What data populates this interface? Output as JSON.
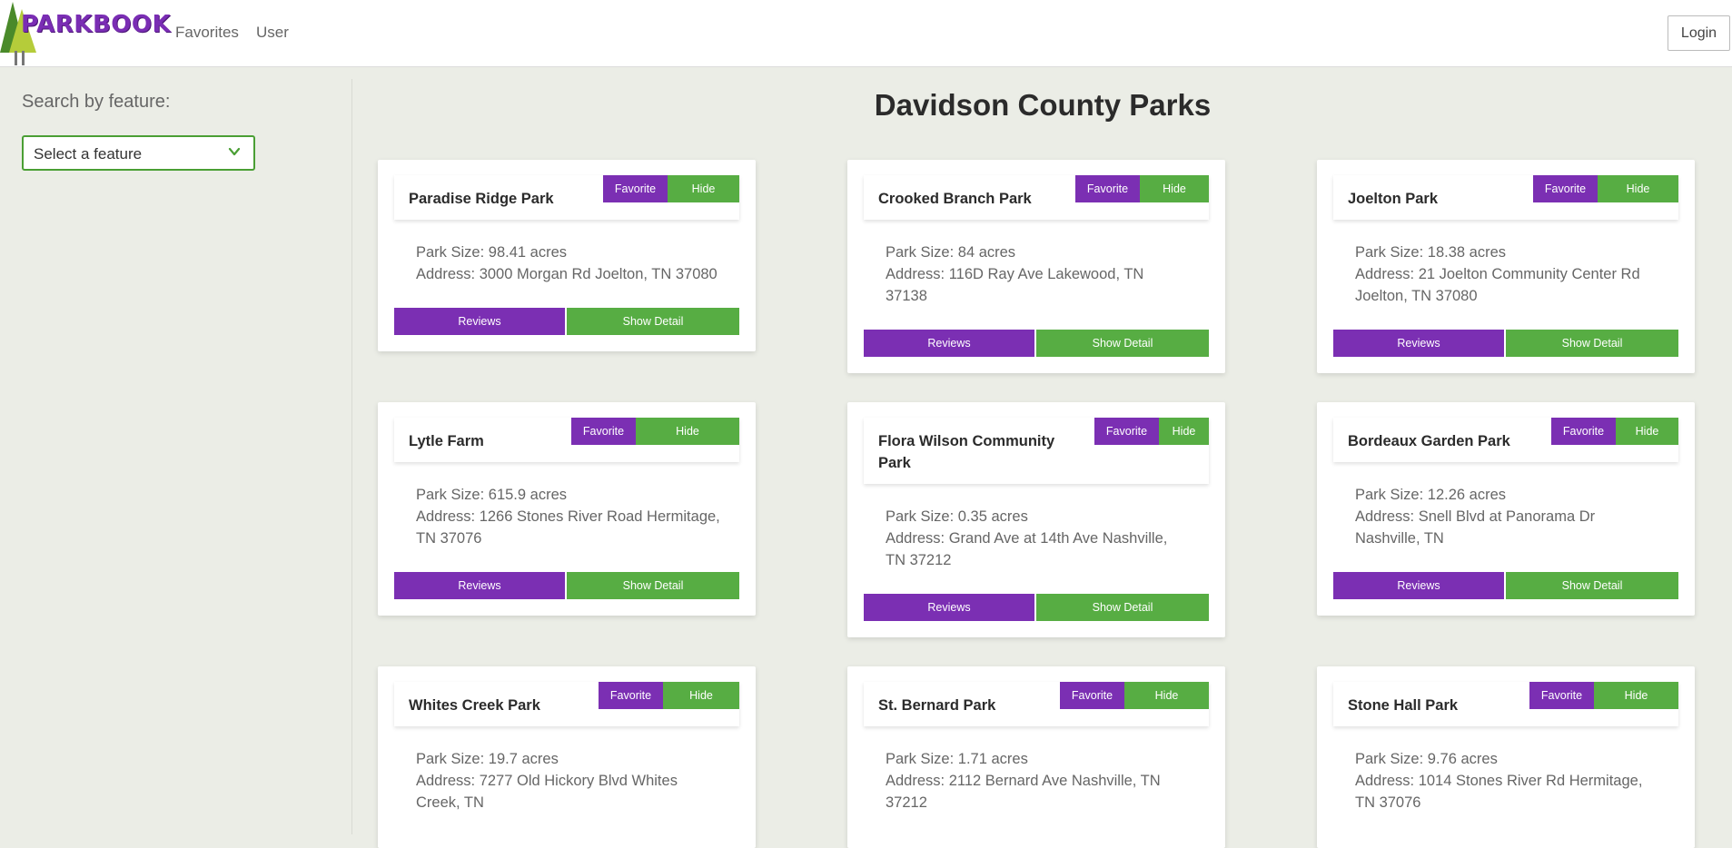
{
  "nav": {
    "logo_text": "PARKBOOK",
    "links": [
      "Favorites",
      "User"
    ],
    "login_label": "Login"
  },
  "sidebar": {
    "label": "Search by feature:",
    "select_value": "Select a feature",
    "select_icon": "chevron-down-icon"
  },
  "main": {
    "title": "Davidson County Parks",
    "parks": [
      {
        "name": "Paradise Ridge Park",
        "size": "Park Size: 98.41 acres",
        "address": "Address: 3000 Morgan Rd Joelton, TN 37080"
      },
      {
        "name": "Crooked Branch Park",
        "size": "Park Size: 84 acres",
        "address": "Address: 116D Ray Ave Lakewood, TN 37138"
      },
      {
        "name": "Joelton Park",
        "size": "Park Size: 18.38 acres",
        "address": "Address: 21 Joelton Community Center Rd Joelton, TN 37080"
      },
      {
        "name": "Lytle Farm",
        "size": "Park Size: 615.9 acres",
        "address": "Address: 1266 Stones River Road Hermitage, TN 37076"
      },
      {
        "name": "Flora Wilson Community Park",
        "size": "Park Size: 0.35 acres",
        "address": "Address: Grand Ave at 14th Ave Nashville, TN 37212"
      },
      {
        "name": "Bordeaux Garden Park",
        "size": "Park Size: 12.26 acres",
        "address": "Address: Snell Blvd at Panorama Dr Nashville, TN"
      },
      {
        "name": "Whites Creek Park",
        "size": "Park Size: 19.7 acres",
        "address": "Address: 7277 Old Hickory Blvd Whites Creek, TN"
      },
      {
        "name": "St. Bernard Park",
        "size": "Park Size: 1.71 acres",
        "address": "Address: 2112 Bernard Ave Nashville, TN 37212"
      },
      {
        "name": "Stone Hall Park",
        "size": "Park Size: 9.76 acres",
        "address": "Address: 1014 Stones River Rd Hermitage, TN 37076"
      }
    ],
    "labels": {
      "favorite": "Favorite",
      "hide": "Hide",
      "reviews": "Reviews",
      "show_detail": "Show Detail"
    }
  },
  "colors": {
    "purple": "#7b2fb3",
    "green": "#57ad43",
    "background": "#ebede6"
  }
}
